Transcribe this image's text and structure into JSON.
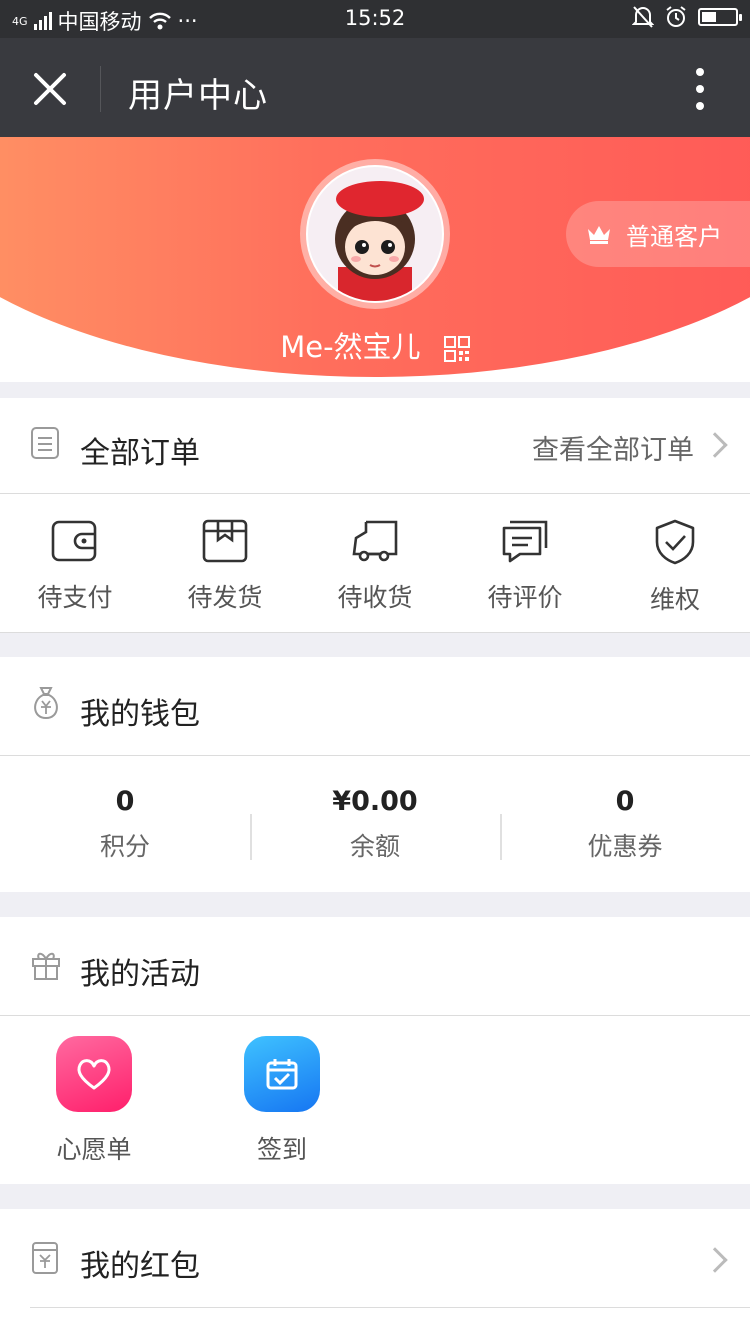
{
  "status": {
    "network": "4G",
    "carrier": "中国移动",
    "dots": "···",
    "time": "15:52",
    "battery_level": 0.45
  },
  "nav": {
    "title": "用户中心"
  },
  "profile": {
    "level_badge": "普通客户",
    "username": "Me-然宝儿"
  },
  "orders": {
    "title": "全部订单",
    "view_all": "查看全部订单",
    "items": [
      {
        "label": "待支付",
        "icon": "wallet-icon"
      },
      {
        "label": "待发货",
        "icon": "box-icon"
      },
      {
        "label": "待收货",
        "icon": "truck-icon"
      },
      {
        "label": "待评价",
        "icon": "comment-icon"
      },
      {
        "label": "维权",
        "icon": "shield-icon"
      }
    ]
  },
  "wallet": {
    "title": "我的钱包",
    "stats": [
      {
        "value": "0",
        "label": "积分"
      },
      {
        "value": "¥0.00",
        "label": "余额"
      },
      {
        "value": "0",
        "label": "优惠券"
      }
    ]
  },
  "activities": {
    "title": "我的活动",
    "items": [
      {
        "label": "心愿单",
        "icon": "heart-icon",
        "color": "#ff3d7f"
      },
      {
        "label": "签到",
        "icon": "calendar-check-icon",
        "color": "#1e9bff"
      }
    ]
  },
  "redpacket": {
    "title": "我的红包"
  },
  "colors": {
    "nav_bg": "#393a3f",
    "status_bg": "#2f3033",
    "header_gradient_start": "#ff9a66",
    "header_gradient_end": "#ff5656"
  }
}
